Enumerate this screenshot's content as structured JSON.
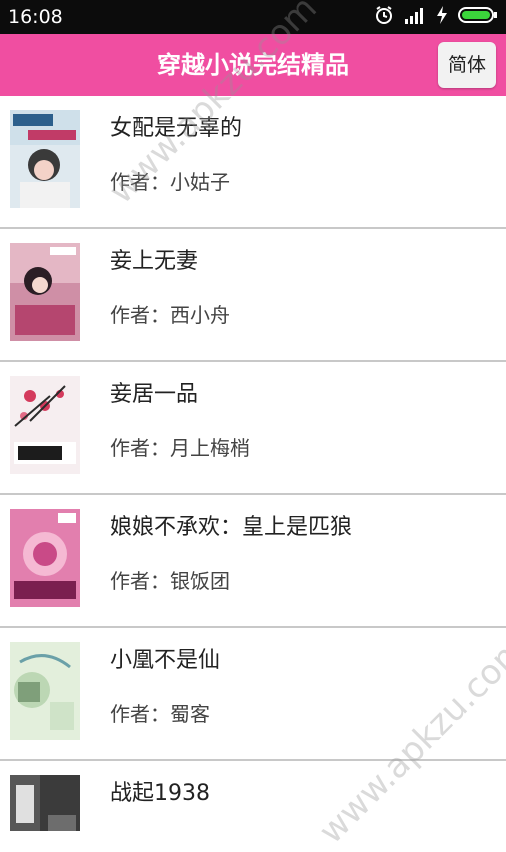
{
  "status_bar": {
    "time": "16:08",
    "icons": [
      "alarm-icon",
      "signal-icon",
      "charging-icon",
      "battery-icon"
    ]
  },
  "header": {
    "title": "穿越小说完结精品",
    "lang_button": "简体",
    "color": "#f04ea1"
  },
  "books": [
    {
      "title": "女配是无辜的",
      "author_label": "作者：",
      "author": "小姑子",
      "cover_color": "#d9e6ee"
    },
    {
      "title": "妾上无妻",
      "author_label": "作者：",
      "author": "西小舟",
      "cover_color": "#d9a3b8"
    },
    {
      "title": "妾居一品",
      "author_label": "作者：",
      "author": "月上梅梢",
      "cover_color": "#f3e8ec"
    },
    {
      "title": "娘娘不承欢：皇上是匹狼",
      "author_label": "作者：",
      "author": "银饭团",
      "cover_color": "#e58bb6"
    },
    {
      "title": "小凰不是仙",
      "author_label": "作者：",
      "author": "蜀客",
      "cover_color": "#d6ead2"
    },
    {
      "title": "战起1938",
      "author_label": "",
      "author": "",
      "cover_color": "#444444"
    }
  ],
  "watermark": "www.apkzu.com"
}
